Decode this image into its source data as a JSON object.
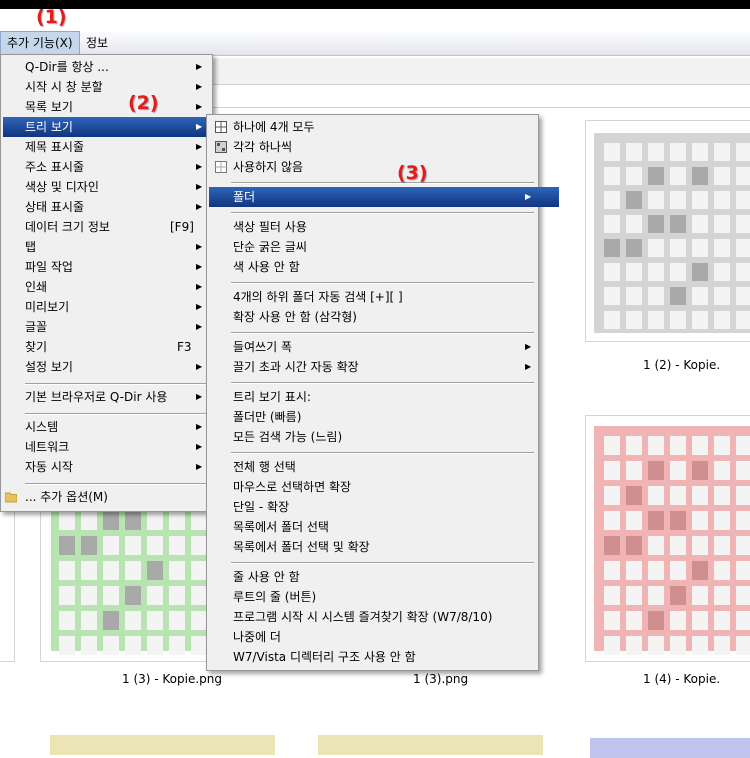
{
  "menubar": {
    "extras": "추가 기능(X)",
    "info": "정보"
  },
  "callouts": {
    "one": "(1)",
    "two": "(2)",
    "three": "(3)"
  },
  "main_menu": {
    "items": [
      "Q-Dir를 항상 ...",
      "시작 시 창 분할",
      "목록 보기",
      "트리 보기",
      "제목 표시줄",
      "주소 표시줄",
      "색상 및 디자인",
      "상태 표시줄",
      "데이터 크기 정보",
      "탭",
      "파일 작업",
      "인쇄",
      "미리보기",
      "글꼴",
      "찾기",
      "설정 보기",
      "기본 브라우저로 Q-Dir 사용",
      "시스템",
      "네트워크",
      "자동 시작",
      "... 추가 옵션(M)"
    ],
    "shortcut_data_size": "[F9]",
    "shortcut_find": "F3"
  },
  "tree_menu": {
    "items": [
      "하나에 4개 모두",
      "각각 하나씩",
      "사용하지 않음",
      "폴더",
      "색상 필터 사용",
      "단순 굵은 글씨",
      "색 사용 안 함",
      "4개의 하위 폴더 자동 검색 [+][ ]",
      "확장 사용 안 함 (삼각형)",
      "들여쓰기 폭",
      "끌기 초과 시간 자동 확장",
      "트리 보기 표시:",
      "폴더만 (빠름)",
      "모든 검색 가능 (느림)",
      "전체 행 선택",
      "마우스로 선택하면 확장",
      "단일 - 확장",
      "목록에서 폴더 선택",
      "목록에서 폴더 선택 및 확장",
      "줄 사용 안 함",
      "루트의 줄 (버튼)",
      "프로그램 시작 시 시스템 즐겨찾기 확장 (W7/8/10)",
      "나중에 더",
      "W7/Vista 디렉터리 구조 사용 안 함"
    ]
  },
  "files": [
    "1 (2) - Kopie.",
    "1 (3) - Kopie.png",
    "1 (3).png",
    "1 (4) - Kopie."
  ],
  "colors": {
    "gray": "#d4d4d4",
    "gray_dark": "#a9a9a9",
    "green": "#b7e4b0",
    "red": "#f0b4b4",
    "red_dark": "#cf8f8f",
    "yellow": "#ebe5b5",
    "blue": "#c0c4ec"
  }
}
